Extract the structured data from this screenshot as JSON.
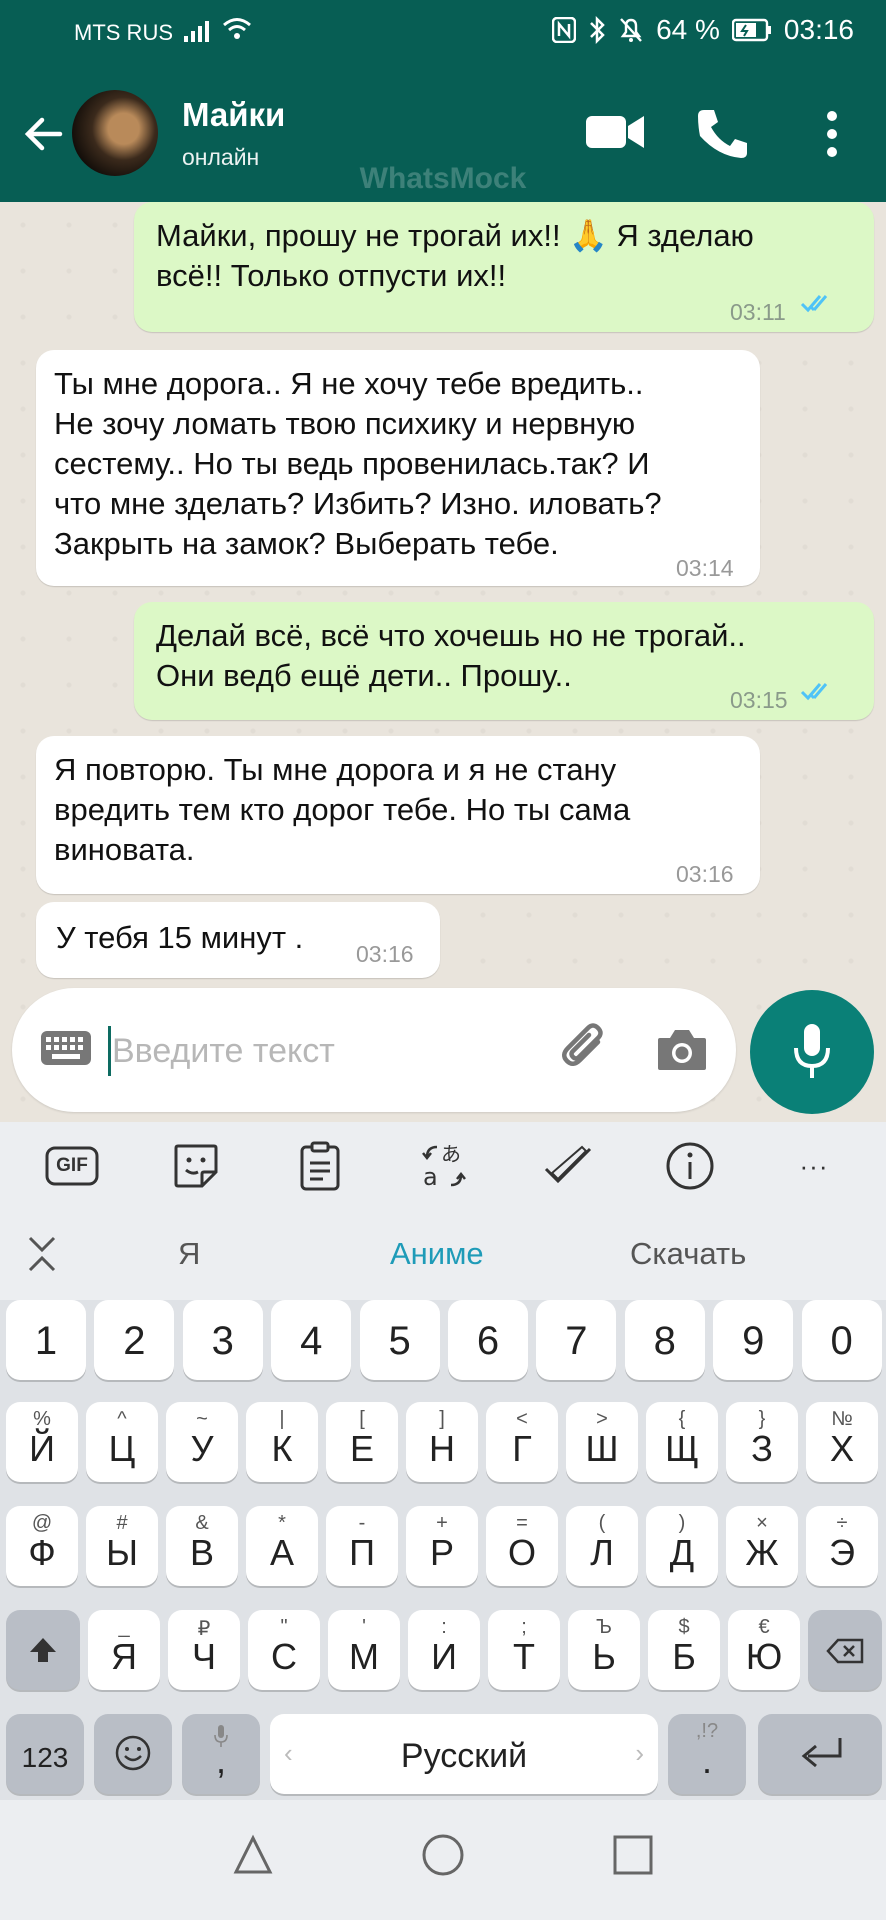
{
  "status_bar": {
    "carrier": "MTS RUS",
    "battery": "64 %",
    "time": "03:16"
  },
  "header": {
    "name": "Майки",
    "status": "онлайн",
    "watermark": "WhatsMock"
  },
  "messages": [
    {
      "dir": "out",
      "text": "Майки, прошу не трогай их!! 🙏 Я зделаю\nвсё!! Только отпусти их!!",
      "time": "03:11",
      "read": true
    },
    {
      "dir": "in",
      "text": "Ты мне дорога.. Я не хочу тебе вредить..\nНе зочу ломать твою психику и нервную\nсестему.. Но ты ведь провенилась.так? И\nчто мне зделать? Избить? Изно. иловать?\nЗакрыть на замок? Выберать тебе.",
      "time": "03:14"
    },
    {
      "dir": "out",
      "text": "Делай всё, всё что хочешь но не трогай..\nОни ведб ещё дети.. Прошу..",
      "time": "03:15",
      "read": true
    },
    {
      "dir": "in",
      "text": "Я повторю. Ты мне дорога и я не стану\nвредить тем кто дорог тебе. Но ты сама\nвиновата.",
      "time": "03:16"
    },
    {
      "dir": "in",
      "text": "У тебя 15 минут .",
      "time": "03:16"
    }
  ],
  "input": {
    "placeholder": "Введите текст",
    "value": ""
  },
  "toolbar": {
    "gif_label": "GIF",
    "more_label": "···"
  },
  "suggestions": [
    "Я",
    "Аниме",
    "Скачать"
  ],
  "keyboard": {
    "number_row": [
      "1",
      "2",
      "3",
      "4",
      "5",
      "6",
      "7",
      "8",
      "9",
      "0"
    ],
    "row1": [
      [
        "Й",
        "%"
      ],
      [
        "Ц",
        "^"
      ],
      [
        "У",
        "~"
      ],
      [
        "К",
        "|"
      ],
      [
        "Е",
        "["
      ],
      [
        "Н",
        "]"
      ],
      [
        "Г",
        "<"
      ],
      [
        "Ш",
        ">"
      ],
      [
        "Щ",
        "{"
      ],
      [
        "З",
        "}"
      ],
      [
        "Х",
        "№"
      ]
    ],
    "row2": [
      [
        "Ф",
        "@"
      ],
      [
        "Ы",
        "#"
      ],
      [
        "В",
        "&"
      ],
      [
        "А",
        "*"
      ],
      [
        "П",
        "-"
      ],
      [
        "Р",
        "+"
      ],
      [
        "О",
        "="
      ],
      [
        "Л",
        "("
      ],
      [
        "Д",
        ")"
      ],
      [
        "Ж",
        "×"
      ],
      [
        "Э",
        "÷"
      ]
    ],
    "row3": [
      [
        "Я",
        "_"
      ],
      [
        "Ч",
        "₽"
      ],
      [
        "С",
        "\""
      ],
      [
        "М",
        "'"
      ],
      [
        "И",
        ":"
      ],
      [
        "Т",
        ";"
      ],
      [
        "Ь",
        "Ъ"
      ],
      [
        "Б",
        "$"
      ],
      [
        "Ю",
        "€"
      ]
    ],
    "mode_label": "123",
    "comma_label": ",",
    "space_label": "Русский",
    "space_left": "‹",
    "space_right": "›",
    "period_label": ".",
    "period_sec": ",!?"
  },
  "accent_color": "#075e54",
  "bubble_out_color": "#dcf8c6",
  "tick_color": "#4fc3f7"
}
